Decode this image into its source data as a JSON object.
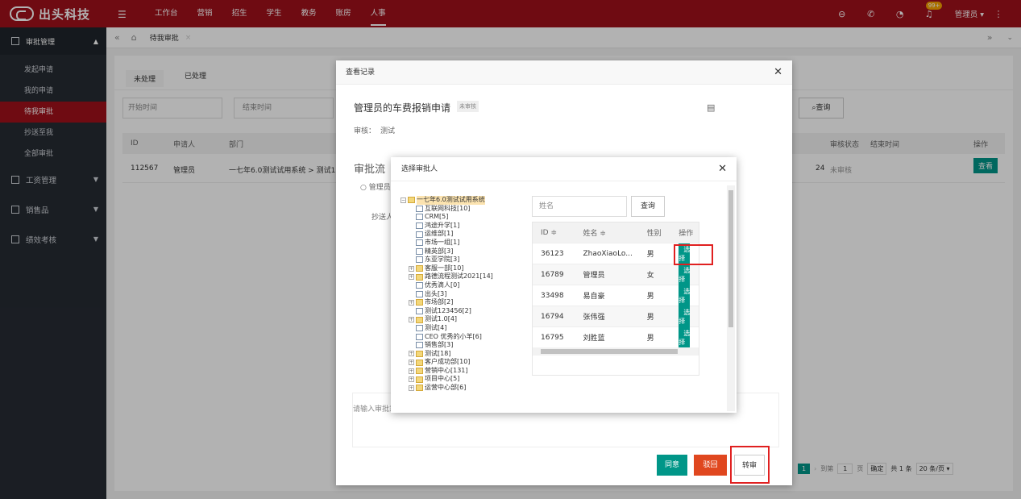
{
  "brand": {
    "name": "出头科技"
  },
  "topnav": [
    "工作台",
    "营销",
    "招生",
    "学生",
    "教务",
    "账房",
    "人事"
  ],
  "topnav_active": "人事",
  "header": {
    "badge": "99+",
    "user": "管理员 ▾",
    "more": "⋮"
  },
  "sidebar": {
    "head": "审批管理",
    "items": [
      "发起申请",
      "我的申请",
      "待我审批",
      "抄送至我",
      "全部审批"
    ],
    "active": "待我审批",
    "groups": [
      "工资管理",
      "销售品",
      "绩效考核"
    ]
  },
  "tabstrip": {
    "tab": "待我审批"
  },
  "main": {
    "tabs": [
      "未处理",
      "已处理"
    ],
    "start_ph": "开始时间",
    "end_ph": "结束时间",
    "query": "查询",
    "columns": [
      "ID",
      "申请人",
      "部门",
      "审核状态",
      "结束时间",
      "操作"
    ],
    "row": {
      "id": "112567",
      "applicant": "管理员",
      "dept": "一七年6.0测试试用系统 > 测试1.",
      "status": "未审核",
      "view": "查看",
      "small": "24"
    },
    "pager": {
      "page": "1",
      "goto": "到第",
      "page_val": "1",
      "page_unit": "页",
      "confirm": "确定",
      "total": "共 1 条",
      "per": "20 条/页 ▾"
    }
  },
  "modal1": {
    "title": "查看记录",
    "heading": "管理员的车费报销申请",
    "status": "未审核",
    "audit_label": "审核：",
    "audit_val": "测试",
    "flow": "审批流",
    "node": "管理员",
    "cc": "抄送人",
    "comment_ph": "请输入审批意见",
    "agree": "同意",
    "reject": "驳回",
    "transfer": "转审"
  },
  "modal2": {
    "title": "选择审批人",
    "name_ph": "姓名",
    "query": "查询",
    "columns": [
      "ID ≑",
      "姓名 ≑",
      "性别",
      "操作"
    ],
    "rows": [
      [
        "36123",
        "ZhaoXiaoLo...",
        "男"
      ],
      [
        "16789",
        "管理员",
        "女"
      ],
      [
        "33498",
        "易自豪",
        "男"
      ],
      [
        "16794",
        "张伟强",
        "男"
      ],
      [
        "16795",
        "刘胜蓝",
        "男"
      ]
    ],
    "select": "选择",
    "tree": [
      [
        "root",
        "一七年6.0测试试用系统"
      ],
      [
        "f",
        "互联网科技[10]"
      ],
      [
        "f",
        "CRM[5]"
      ],
      [
        "f",
        "鸿途升学[1]"
      ],
      [
        "f",
        "运维部[1]"
      ],
      [
        "f",
        "市场一组[1]"
      ],
      [
        "f",
        "精英部[3]"
      ],
      [
        "f",
        "东亚学院[3]"
      ],
      [
        "p",
        "客服一部[10]"
      ],
      [
        "p",
        "路德流程测试2021[14]"
      ],
      [
        "f",
        "优秀滴人[0]"
      ],
      [
        "f",
        "出头[3]"
      ],
      [
        "p",
        "市场部[2]"
      ],
      [
        "f",
        "测试123456[2]"
      ],
      [
        "p",
        "测试1.0[4]"
      ],
      [
        "f",
        "测试[4]"
      ],
      [
        "f",
        "CEO 优秀的小羊[6]"
      ],
      [
        "f",
        "销售部[3]"
      ],
      [
        "p",
        "测试[18]"
      ],
      [
        "p",
        "客户成功部[10]"
      ],
      [
        "p",
        "营销中心[131]"
      ],
      [
        "p",
        "项目中心[5]"
      ],
      [
        "p",
        "运营中心部[6]"
      ]
    ]
  }
}
